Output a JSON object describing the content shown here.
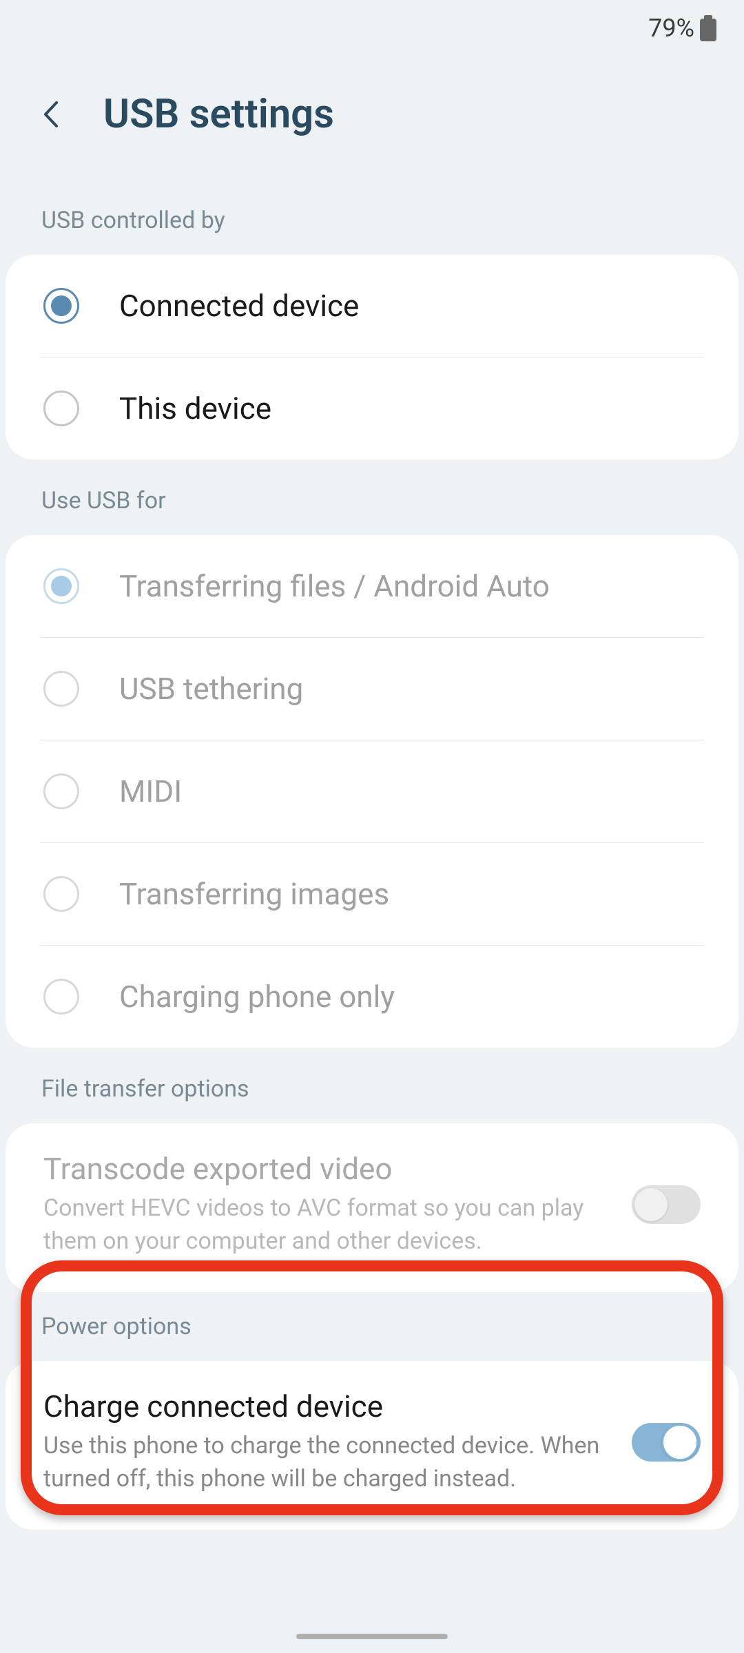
{
  "statusbar": {
    "battery_pct": "79%"
  },
  "header": {
    "title": "USB settings"
  },
  "section1": {
    "label": "USB controlled by",
    "items": [
      {
        "label": "Connected device",
        "selected": true
      },
      {
        "label": "This device",
        "selected": false
      }
    ]
  },
  "section2": {
    "label": "Use USB for",
    "items": [
      {
        "label": "Transferring files / Android Auto",
        "selected": true
      },
      {
        "label": "USB tethering",
        "selected": false
      },
      {
        "label": "MIDI",
        "selected": false
      },
      {
        "label": "Transferring images",
        "selected": false
      },
      {
        "label": "Charging phone only",
        "selected": false
      }
    ]
  },
  "section3": {
    "label": "File transfer options",
    "transcode": {
      "title": "Transcode exported video",
      "desc": "Convert HEVC videos to AVC format so you can play them on your computer and other devices."
    }
  },
  "section4": {
    "label": "Power options",
    "charge": {
      "title": "Charge connected device",
      "desc": "Use this phone to charge the connected device. When turned off, this phone will be charged instead."
    }
  }
}
